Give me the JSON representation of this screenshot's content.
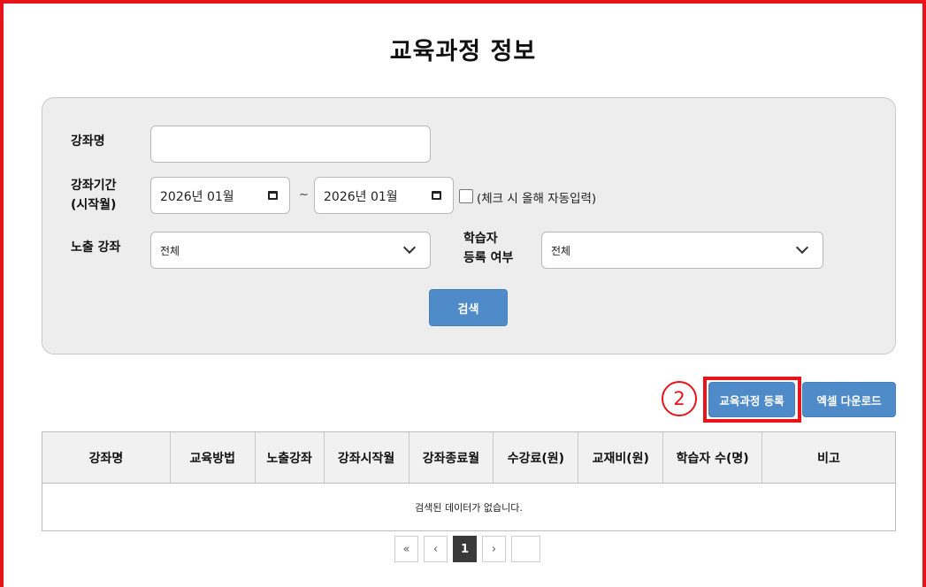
{
  "page": {
    "title": "교육과정 정보"
  },
  "search": {
    "course_name_label": "강좌명",
    "course_name_value": "",
    "period_label_line1": "강좌기간",
    "period_label_line2": "(시작월)",
    "start_month": "2026년 01월",
    "range_separator": "~",
    "end_month": "2026년 01월",
    "auto_fill_label": "(체크 시 올해 자동입력)",
    "auto_fill_checked": false,
    "exposure_label": "노출 강좌",
    "exposure_value": "전체",
    "learner_label_line1": "학습자",
    "learner_label_line2": "등록 여부",
    "learner_value": "전체",
    "search_button": "검색"
  },
  "annotation": {
    "step_number": "2",
    "color": "#e8141b"
  },
  "actions": {
    "register_button": "교육과정 등록",
    "excel_button": "엑셀 다운로드"
  },
  "table": {
    "columns": [
      "강좌명",
      "교육방법",
      "노출강좌",
      "강좌시작월",
      "강좌종료월",
      "수강료(원)",
      "교재비(원)",
      "학습자 수(명)",
      "비고"
    ],
    "empty_message": "검색된 데이터가 없습니다."
  },
  "pagination": {
    "first": "«",
    "prev": "‹",
    "current": "1",
    "next": "›"
  },
  "colors": {
    "accent": "#4e8bc8",
    "annotation": "#e8141b",
    "panel": "#ededee"
  }
}
